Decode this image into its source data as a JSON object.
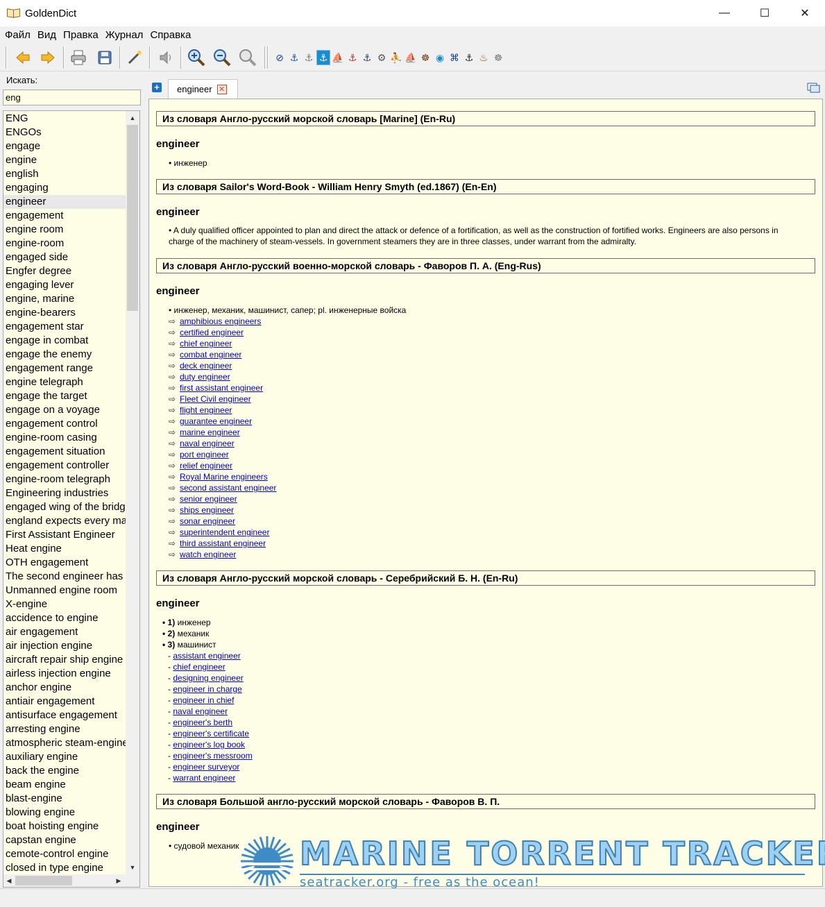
{
  "window": {
    "title": "GoldenDict",
    "minimize_glyph": "—",
    "maximize_glyph": "☐",
    "close_glyph": "✕"
  },
  "menu": [
    "Файл",
    "Вид",
    "Правка",
    "Журнал",
    "Справка"
  ],
  "toolbar": {
    "buttons": [
      "back-icon",
      "forward-icon",
      "print-icon",
      "save-icon",
      "scan-popup-icon",
      "pronounce-icon",
      "zoom-in-icon",
      "zoom-out-icon",
      "zoom-reset-icon"
    ],
    "dictionaries": [
      {
        "icon": "compass-disc-icon",
        "glyph": "⊘",
        "color": "#1d3f8f"
      },
      {
        "icon": "anchor-icon",
        "glyph": "⚓",
        "color": "#1d4fa0"
      },
      {
        "icon": "anchor-gray-icon",
        "glyph": "⚓",
        "color": "#777"
      },
      {
        "icon": "anchor-framed-icon",
        "glyph": "⚓",
        "color": "#ffffff",
        "active": true
      },
      {
        "icon": "ship-icon",
        "glyph": "⛵",
        "color": "#8a5a2a"
      },
      {
        "icon": "anchor-red-icon",
        "glyph": "⚓",
        "color": "#b03030"
      },
      {
        "icon": "anchor-dark-icon",
        "glyph": "⚓",
        "color": "#2b3a6b"
      },
      {
        "icon": "gear-disc-icon",
        "glyph": "⚙",
        "color": "#555"
      },
      {
        "icon": "sailor-icon",
        "glyph": "⛹",
        "color": "#3a6fb0"
      },
      {
        "icon": "sailing-ship-icon",
        "glyph": "⛵",
        "color": "#9b7a3a"
      },
      {
        "icon": "helm-icon",
        "glyph": "☸",
        "color": "#6b3a1a"
      },
      {
        "icon": "globe-icon",
        "glyph": "◉",
        "color": "#1a8ccf"
      },
      {
        "icon": "sail-icon",
        "glyph": "⌘",
        "color": "#1d3f8f"
      },
      {
        "icon": "anchor-black-icon",
        "glyph": "⚓",
        "color": "#222"
      },
      {
        "icon": "diver-helmet-icon",
        "glyph": "♨",
        "color": "#8a4a1a"
      },
      {
        "icon": "wheel-icon",
        "glyph": "☸",
        "color": "#777"
      }
    ]
  },
  "search": {
    "label": "Искать:",
    "value": "eng"
  },
  "wordlist": {
    "selected_index": 6,
    "items": [
      "ENG",
      "ENGOs",
      "engage",
      "engine",
      "english",
      "engaging",
      "engineer",
      "engagement",
      "engine room",
      "engine-room",
      "engaged side",
      "Engfer degree",
      "engaging lever",
      "engine, marine",
      "engine-bearers",
      "engagement star",
      "engage in combat",
      "engage the enemy",
      "engagement range",
      "engine telegraph",
      "engage the target",
      "engage on a voyage",
      "engagement control",
      "engine-room casing",
      "engagement situation",
      "engagement controller",
      "engine-room telegraph",
      "Engineering industries",
      "engaged wing of the bridge",
      "england expects every man",
      "First Assistant Engineer",
      "Heat engine",
      "OTH engagement",
      "The second engineer has a",
      "Unmanned engine room",
      "X-engine",
      "accidence to engine",
      "air engagement",
      "air injection engine",
      "aircraft repair ship engine",
      "airless injection engine",
      "anchor engine",
      "antiair engagement",
      "antisurface engagement",
      "arresting engine",
      "atmospheric steam-engine",
      "auxiliary engine",
      "back the engine",
      "beam engine",
      "blast-engine",
      "blowing engine",
      "boat hoisting engine",
      "capstan engine",
      "cemote-control engine",
      "closed in type engine"
    ]
  },
  "tabs": [
    {
      "label": "engineer",
      "close_glyph": "✕"
    }
  ],
  "new_tab_glyph": "+",
  "article": {
    "sections": [
      {
        "header": "Из словаря Англо-русский морской словарь [Marine] (En-Ru)",
        "headword": "engineer",
        "lines": [
          {
            "kind": "bullet",
            "text": "инженер"
          }
        ]
      },
      {
        "header": "Из словаря Sailor's Word-Book - William Henry Smyth (ed.1867) (En-En)",
        "headword": "engineer",
        "paragraph": "A duly qualified officer appointed to plan and direct the attack or defence of a fortification, as well as the construction of fortified works. Engineers are also persons in charge of the machinery of steam-vessels. In government steamers they are in three classes, under warrant from the admiralty."
      },
      {
        "header": "Из словаря Англо-русский военно-морской словарь - Фаворов П. А. (Eng-Rus)",
        "headword": "engineer",
        "lines": [
          {
            "kind": "bullet",
            "text": "инженер, механик, машинист, сапер; pl. инженерные войска"
          },
          {
            "kind": "link",
            "text": "amphibious engineers"
          },
          {
            "kind": "link",
            "text": "certified engineer"
          },
          {
            "kind": "link",
            "text": "chief engineer"
          },
          {
            "kind": "link",
            "text": "combat engineer"
          },
          {
            "kind": "link",
            "text": "deck engineer"
          },
          {
            "kind": "link",
            "text": "duty engineer"
          },
          {
            "kind": "link",
            "text": "first assistant engineer"
          },
          {
            "kind": "link",
            "text": "Fleet Civil engineer"
          },
          {
            "kind": "link",
            "text": "flight engineer"
          },
          {
            "kind": "link",
            "text": "guarantee engineer"
          },
          {
            "kind": "link",
            "text": "marine engineer"
          },
          {
            "kind": "link",
            "text": "naval engineer"
          },
          {
            "kind": "link",
            "text": "port engineer"
          },
          {
            "kind": "link",
            "text": "relief engineer"
          },
          {
            "kind": "link",
            "text": "Royal Marine engineers"
          },
          {
            "kind": "link",
            "text": "second assistant engineer"
          },
          {
            "kind": "link",
            "text": "senior engineer"
          },
          {
            "kind": "link",
            "text": "ships engineer"
          },
          {
            "kind": "link",
            "text": "sonar engineer"
          },
          {
            "kind": "link",
            "text": "superintendent engineer"
          },
          {
            "kind": "link",
            "text": "third assistant engineer"
          },
          {
            "kind": "link",
            "text": "watch engineer"
          }
        ]
      },
      {
        "header": "Из словаря Англо-русский морской словарь - Серебрийский Б. Н. (En-Ru)",
        "headword": "engineer",
        "lines": [
          {
            "kind": "numbered",
            "num": "1)",
            "text": "инженер"
          },
          {
            "kind": "numbered",
            "num": "2)",
            "text": "механик"
          },
          {
            "kind": "numbered",
            "num": "3)",
            "text": "машинист"
          },
          {
            "kind": "dash",
            "text": "assistant engineer"
          },
          {
            "kind": "dash",
            "text": "chief engineer"
          },
          {
            "kind": "dash",
            "text": "designing engineer"
          },
          {
            "kind": "dash",
            "text": "engineer in charge"
          },
          {
            "kind": "dash",
            "text": "engineer in chief"
          },
          {
            "kind": "dash",
            "text": "naval engineer"
          },
          {
            "kind": "dash",
            "text": "engineer's berth"
          },
          {
            "kind": "dash",
            "text": "engineer's certificate"
          },
          {
            "kind": "dash",
            "text": "engineer's log book"
          },
          {
            "kind": "dash",
            "text": "engineer's messroom"
          },
          {
            "kind": "dash",
            "text": "engineer surveyor"
          },
          {
            "kind": "dash",
            "text": "warrant engineer"
          }
        ]
      },
      {
        "header": "Из словаря Большой англо-русский морской словарь - Фаворов В. П.",
        "headword": "engineer",
        "lines": [
          {
            "kind": "bullet",
            "text": "судовой механик"
          }
        ]
      }
    ]
  },
  "watermark": {
    "title": "MARINE TORRENT TRACKER",
    "subtitle": "seatracker.org - free as the ocean!"
  }
}
